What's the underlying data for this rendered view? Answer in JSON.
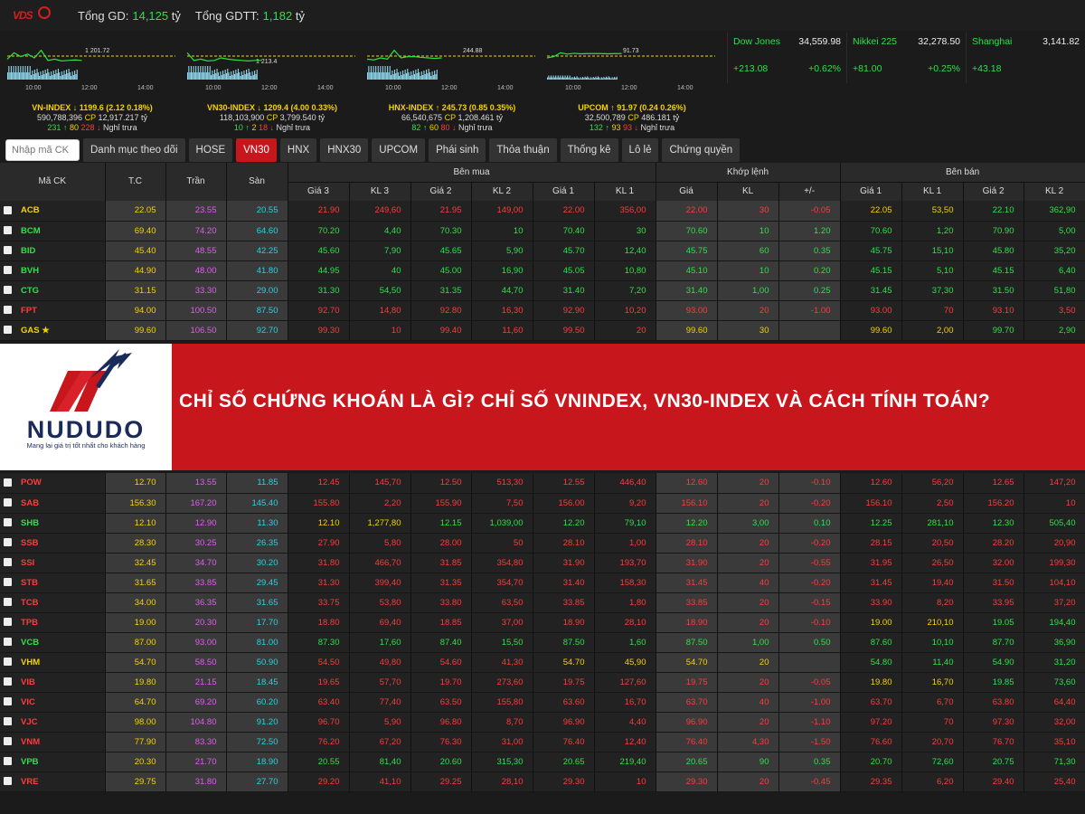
{
  "topbar": {
    "logo_text": "VDS",
    "total_gd_label": "Tổng GD:",
    "total_gd_value": "14,125",
    "total_gd_unit": "tỷ",
    "total_gdtt_label": "Tổng GDTT:",
    "total_gdtt_value": "1,182",
    "total_gdtt_unit": "tỷ"
  },
  "indices": [
    {
      "name": "VN-INDEX ↓ 1199.6 (2.12 0.18%)",
      "ref_label": "1 201.72",
      "vol": "590,788,396",
      "cp_label": "CP",
      "val": "12,917.217 tỷ",
      "up": "231 ↑",
      "ref": "80",
      "down": "228 ↓",
      "status": "Nghỉ trưa",
      "times": [
        "10:00",
        "12:00",
        "14:00"
      ],
      "color": "#f5d200"
    },
    {
      "name": "VN30-INDEX ↓ 1209.4 (4.00 0.33%)",
      "ref_label": "1 213.4",
      "vol": "118,103,900",
      "cp_label": "CP",
      "val": "3,799.540 tỷ",
      "up": "10 ↑",
      "ref": "2",
      "down": "18 ↓",
      "status": "Nghỉ trưa",
      "times": [
        "10:00",
        "12:00",
        "14:00"
      ],
      "color": "#f5d200"
    },
    {
      "name": "HNX-INDEX ↑ 245.73 (0.85 0.35%)",
      "ref_label": "244.88",
      "vol": "66,540,675",
      "cp_label": "CP",
      "val": "1,208.461 tỷ",
      "up": "82 ↑",
      "ref": "60",
      "down": "80 ↓",
      "status": "Nghỉ trưa",
      "times": [
        "10:00",
        "12:00",
        "14:00"
      ],
      "color": "#f5d200"
    },
    {
      "name": "UPCOM ↑ 91.97 (0.24 0.26%)",
      "ref_label": "91.73",
      "vol": "32,500,789",
      "cp_label": "CP",
      "val": "486.181 tỷ",
      "up": "132 ↑",
      "ref": "93",
      "down": "93 ↓",
      "status": "Nghỉ trưa",
      "times": [
        "10:00",
        "12:00",
        "14:00"
      ],
      "color": "#f5d200"
    }
  ],
  "world": [
    {
      "name": "Dow Jones",
      "value": "34,559.98",
      "change": "+213.08",
      "pct": "+0.62%"
    },
    {
      "name": "Nikkei 225",
      "value": "32,278.50",
      "change": "+81.00",
      "pct": "+0.25%"
    },
    {
      "name": "Shanghai",
      "value": "3,141.82",
      "change": "+43.18",
      "pct": ""
    }
  ],
  "search": {
    "placeholder": "Nhập mã CK"
  },
  "tabs": [
    "Danh mục theo dõi",
    "HOSE",
    "VN30",
    "HNX",
    "HNX30",
    "UPCOM",
    "Phái sinh",
    "Thỏa thuận",
    "Thống kê",
    "Lô lẻ",
    "Chứng quyền"
  ],
  "active_tab": "VN30",
  "header": {
    "symbol": "Mã CK",
    "ref": "T.C",
    "ceil": "Trần",
    "floor": "Sàn",
    "buy_group": "Bên mua",
    "match_group": "Khớp lệnh",
    "sell_group": "Bên bán",
    "cols": [
      "Giá 3",
      "KL 3",
      "Giá 2",
      "KL 2",
      "Giá 1",
      "KL 1",
      "Giá",
      "KL",
      "+/-",
      "Giá 1",
      "KL 1",
      "Giá 2",
      "KL 2"
    ]
  },
  "rows_top": [
    [
      "ACB",
      "22.05",
      "23.55",
      "20.55",
      "21.90",
      "249,60",
      "21.95",
      "149,00",
      "22.00",
      "356,00",
      "22.00",
      "30",
      "-0.05",
      "22.05",
      "53,50",
      "22.10",
      "362,90",
      "y"
    ],
    [
      "BCM",
      "69.40",
      "74.20",
      "64.60",
      "70.20",
      "4,40",
      "70.30",
      "10",
      "70.40",
      "30",
      "70.60",
      "10",
      "1.20",
      "70.60",
      "1,20",
      "70.90",
      "5,00",
      "g"
    ],
    [
      "BID",
      "45.40",
      "48.55",
      "42.25",
      "45.60",
      "7,90",
      "45.65",
      "5,90",
      "45.70",
      "12,40",
      "45.75",
      "60",
      "0.35",
      "45.75",
      "15,10",
      "45.80",
      "35,20",
      "g"
    ],
    [
      "BVH",
      "44.90",
      "48.00",
      "41.80",
      "44.95",
      "40",
      "45.00",
      "16,90",
      "45.05",
      "10,80",
      "45.10",
      "10",
      "0.20",
      "45.15",
      "5,10",
      "45.15",
      "6,40",
      "g"
    ],
    [
      "CTG",
      "31.15",
      "33.30",
      "29.00",
      "31.30",
      "54,50",
      "31.35",
      "44,70",
      "31.40",
      "7,20",
      "31.40",
      "1,00",
      "0.25",
      "31.45",
      "37,30",
      "31.50",
      "51,80",
      "g"
    ],
    [
      "FPT",
      "94.00",
      "100.50",
      "87.50",
      "92.70",
      "14,80",
      "92.80",
      "16,30",
      "92.90",
      "10,20",
      "93.00",
      "20",
      "-1.00",
      "93.00",
      "70",
      "93.10",
      "3,50",
      "r"
    ],
    [
      "GAS ★",
      "99.60",
      "106.50",
      "92.70",
      "99.30",
      "10",
      "99.40",
      "11,60",
      "99.50",
      "20",
      "99.60",
      "30",
      "",
      "99.60",
      "2,00",
      "99.70",
      "2,90",
      "y"
    ]
  ],
  "rows_bottom": [
    [
      "POW",
      "12.70",
      "13.55",
      "11.85",
      "12.45",
      "145,70",
      "12.50",
      "513,30",
      "12.55",
      "446,40",
      "12.60",
      "20",
      "-0.10",
      "12.60",
      "56,20",
      "12.65",
      "147,20",
      "r"
    ],
    [
      "SAB",
      "156.30",
      "167.20",
      "145.40",
      "155.80",
      "2,20",
      "155.90",
      "7,50",
      "156.00",
      "9,20",
      "156.10",
      "20",
      "-0.20",
      "156.10",
      "2,50",
      "156.20",
      "10",
      "r"
    ],
    [
      "SHB",
      "12.10",
      "12.90",
      "11.30",
      "12.10",
      "1,277,80",
      "12.15",
      "1,039,00",
      "12.20",
      "79,10",
      "12.20",
      "3,00",
      "0.10",
      "12.25",
      "281,10",
      "12.30",
      "505,40",
      "g"
    ],
    [
      "SSB",
      "28.30",
      "30.25",
      "26.35",
      "27.90",
      "5,80",
      "28.00",
      "50",
      "28.10",
      "1,00",
      "28.10",
      "20",
      "-0.20",
      "28.15",
      "20,50",
      "28.20",
      "20,90",
      "r"
    ],
    [
      "SSI",
      "32.45",
      "34.70",
      "30.20",
      "31.80",
      "466,70",
      "31.85",
      "354,80",
      "31.90",
      "193,70",
      "31.90",
      "20",
      "-0.55",
      "31.95",
      "26,50",
      "32.00",
      "199,30",
      "r"
    ],
    [
      "STB",
      "31.65",
      "33.85",
      "29.45",
      "31.30",
      "399,40",
      "31.35",
      "354,70",
      "31.40",
      "158,30",
      "31.45",
      "40",
      "-0.20",
      "31.45",
      "19,40",
      "31.50",
      "104,10",
      "r"
    ],
    [
      "TCB",
      "34.00",
      "36.35",
      "31.65",
      "33.75",
      "53,80",
      "33.80",
      "63,50",
      "33.85",
      "1,80",
      "33.85",
      "20",
      "-0.15",
      "33.90",
      "8,20",
      "33.95",
      "37,20",
      "r"
    ],
    [
      "TPB",
      "19.00",
      "20.30",
      "17.70",
      "18.80",
      "69,40",
      "18.85",
      "37,00",
      "18.90",
      "28,10",
      "18.90",
      "20",
      "-0.10",
      "19.00",
      "210,10",
      "19.05",
      "194,40",
      "r"
    ],
    [
      "VCB",
      "87.00",
      "93.00",
      "81.00",
      "87.30",
      "17,60",
      "87.40",
      "15,50",
      "87.50",
      "1,60",
      "87.50",
      "1,00",
      "0.50",
      "87.60",
      "10,10",
      "87.70",
      "36,90",
      "g"
    ],
    [
      "VHM",
      "54.70",
      "58.50",
      "50.90",
      "54.50",
      "49,80",
      "54.60",
      "41,30",
      "54.70",
      "45,90",
      "54.70",
      "20",
      "",
      "54.80",
      "11,40",
      "54.90",
      "31,20",
      "y"
    ],
    [
      "VIB",
      "19.80",
      "21.15",
      "18.45",
      "19.65",
      "57,70",
      "19.70",
      "273,60",
      "19.75",
      "127,60",
      "19.75",
      "20",
      "-0.05",
      "19.80",
      "16,70",
      "19.85",
      "73,60",
      "r"
    ],
    [
      "VIC",
      "64.70",
      "69.20",
      "60.20",
      "63.40",
      "77,40",
      "63.50",
      "155,80",
      "63.60",
      "16,70",
      "63.70",
      "40",
      "-1.00",
      "63.70",
      "6,70",
      "63.80",
      "64,40",
      "r"
    ],
    [
      "VJC",
      "98.00",
      "104.80",
      "91.20",
      "96.70",
      "5,90",
      "96.80",
      "8,70",
      "96.90",
      "4,40",
      "96.90",
      "20",
      "-1.10",
      "97.20",
      "70",
      "97.30",
      "32,00",
      "r"
    ],
    [
      "VNM",
      "77.90",
      "83.30",
      "72.50",
      "76.20",
      "67,20",
      "76.30",
      "31,00",
      "76.40",
      "12,40",
      "76.40",
      "4,30",
      "-1.50",
      "76.60",
      "20,70",
      "76.70",
      "35,10",
      "r"
    ],
    [
      "VPB",
      "20.30",
      "21.70",
      "18.90",
      "20.55",
      "81,40",
      "20.60",
      "315,30",
      "20.65",
      "219,40",
      "20.65",
      "90",
      "0.35",
      "20.70",
      "72,60",
      "20.75",
      "71,30",
      "g"
    ],
    [
      "VRE",
      "29.75",
      "31.80",
      "27.70",
      "29.20",
      "41,10",
      "29.25",
      "28,10",
      "29.30",
      "10",
      "29.30",
      "20",
      "-0.45",
      "29.35",
      "6,20",
      "29.40",
      "25,40",
      "r"
    ]
  ],
  "banner": {
    "brand": "NUDUDO",
    "slogan": "Mang lại giá trị tốt nhất cho khách hàng",
    "headline": "CHỈ SỐ CHỨNG KHOÁN LÀ GÌ? CHỈ SỐ VNINDEX, VN30-INDEX VÀ CÁCH TÍNH TOÁN?",
    "colors": {
      "red": "#c8161d",
      "navy": "#1a2a5a"
    }
  },
  "colors": {
    "up": "#2ee04a",
    "down": "#ff3b3b",
    "ref": "#f5d200",
    "ceil": "#e05cf0",
    "floor": "#28d2e0"
  }
}
